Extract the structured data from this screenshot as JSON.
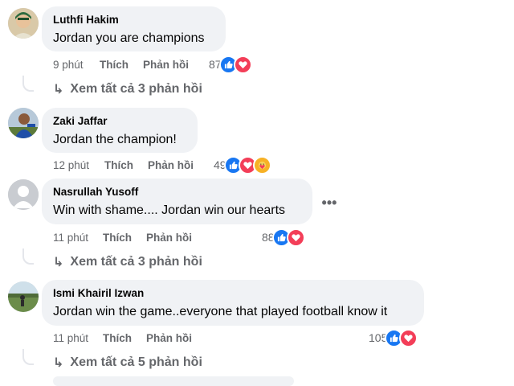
{
  "comments": [
    {
      "author": "Luthfi Hakim",
      "text": "Jordan you are champions",
      "time": "9 phút",
      "like_label": "Thích",
      "reply_label": "Phản hồi",
      "reaction_count": "87",
      "reactions": [
        "like-icon",
        "love-icon"
      ],
      "view_replies": "Xem tất cả 3 phản hồi"
    },
    {
      "author": "Zaki Jaffar",
      "text": "Jordan the champion!",
      "time": "12 phút",
      "like_label": "Thích",
      "reply_label": "Phản hồi",
      "reaction_count": "49",
      "reactions": [
        "like-icon",
        "love-icon",
        "care-icon"
      ]
    },
    {
      "author": "Nasrullah Yusoff",
      "text": "Win with shame.... Jordan win our hearts",
      "time": "11 phút",
      "like_label": "Thích",
      "reply_label": "Phản hồi",
      "reaction_count": "88",
      "reactions": [
        "like-icon",
        "love-icon"
      ],
      "view_replies": "Xem tất cả 3 phản hồi",
      "more_label": "•••"
    },
    {
      "author": "Ismi Khairil Izwan",
      "text": "Jordan win the game..everyone that played football know it",
      "time": "11 phút",
      "like_label": "Thích",
      "reply_label": "Phản hồi",
      "reaction_count": "105",
      "reactions": [
        "like-icon",
        "love-icon"
      ],
      "view_replies": "Xem tất cả 5 phản hồi"
    }
  ],
  "colors": {
    "bubble": "#f0f2f5",
    "meta_text": "#65676b",
    "like": "#1877f2",
    "love": "#f33e58",
    "care": "#f7b125"
  }
}
